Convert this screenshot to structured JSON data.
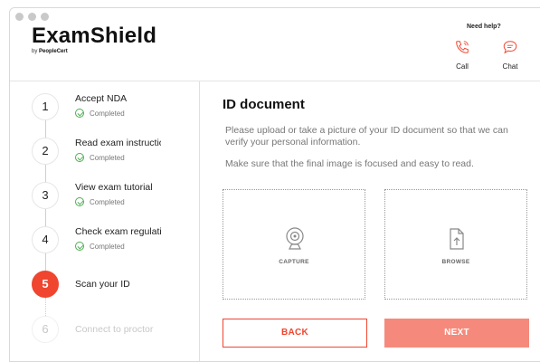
{
  "header": {
    "logo_name": "ExamShield",
    "logo_by": "by",
    "logo_company": "PeopleCert",
    "help_title": "Need help?",
    "call_label": "Call",
    "chat_label": "Chat"
  },
  "steps": [
    {
      "num": "1",
      "title": "Accept NDA",
      "status": "Completed"
    },
    {
      "num": "2",
      "title": "Read exam instructions",
      "status": "Completed"
    },
    {
      "num": "3",
      "title": "View exam tutorial",
      "status": "Completed"
    },
    {
      "num": "4",
      "title": "Check exam regulations",
      "status": "Completed"
    },
    {
      "num": "5",
      "title": "Scan your ID",
      "status": ""
    },
    {
      "num": "6",
      "title": "Connect to proctor",
      "status": ""
    }
  ],
  "main": {
    "title": "ID document",
    "paragraph1": "Please upload or take a picture of your ID document so that we can verify your personal information.",
    "paragraph2": "Make sure that the final image is focused and easy to read.",
    "capture_label": "CAPTURE",
    "browse_label": "BROWSE",
    "back_label": "BACK",
    "next_label": "NEXT"
  },
  "colors": {
    "accent": "#f0452f",
    "next_button": "#f58a7c",
    "completed": "#4caf50"
  },
  "icons": [
    "phone-icon",
    "chat-icon",
    "check-circle-icon",
    "webcam-icon",
    "file-upload-icon"
  ]
}
